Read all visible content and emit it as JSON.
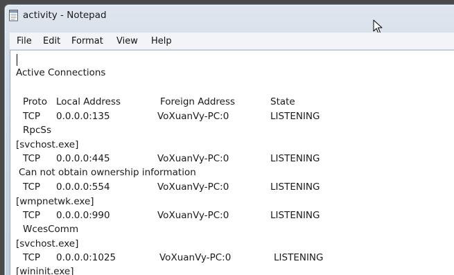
{
  "window": {
    "title": "activity - Notepad"
  },
  "menu": {
    "file": "File",
    "edit": "Edit",
    "format": "Format",
    "view": "View",
    "help": "Help"
  },
  "document": {
    "heading": "Active Connections",
    "columns": {
      "proto": "Proto",
      "local": "Local Address",
      "foreign": "Foreign Address",
      "state": "State"
    },
    "rows": [
      {
        "proto": "TCP",
        "local": "0.0.0.0:135",
        "foreign": "VoXuanVy-PC:0",
        "state": "LISTENING"
      },
      {
        "proto": "TCP",
        "local": "0.0.0.0:445",
        "foreign": "VoXuanVy-PC:0",
        "state": "LISTENING"
      },
      {
        "proto": "TCP",
        "local": "0.0.0.0:554",
        "foreign": "VoXuanVy-PC:0",
        "state": "LISTENING"
      },
      {
        "proto": "TCP",
        "local": "0.0.0.0:990",
        "foreign": "VoXuanVy-PC:0",
        "state": "LISTENING"
      },
      {
        "proto": "TCP",
        "local": "0.0.0.0:1025",
        "foreign": "VoXuanVy-PC:0",
        "state": "LISTENING"
      }
    ],
    "info_lines": [
      "RpcSs",
      "[svchost.exe]",
      "Can not obtain ownership information",
      "[wmpnetwk.exe]",
      "WcesComm",
      "[svchost.exe]",
      "[wininit.exe]"
    ]
  }
}
